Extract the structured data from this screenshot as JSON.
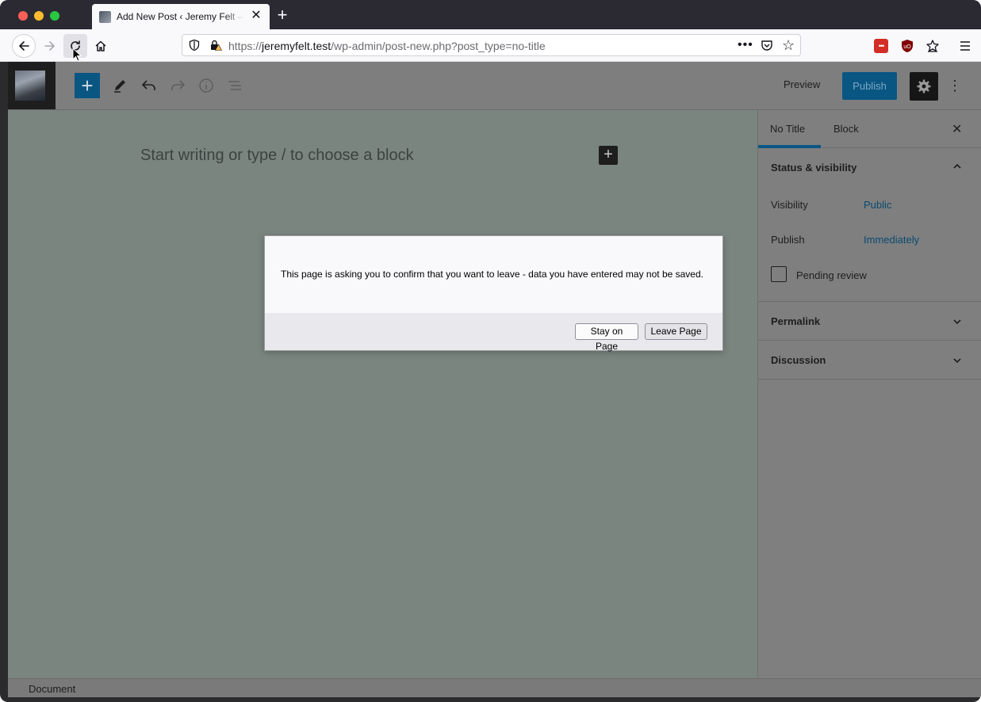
{
  "browser": {
    "tab_title": "Add New Post ‹ Jeremy Felt — WordPress",
    "tab_close": "✕",
    "new_tab": "+",
    "url_scheme": "https://",
    "url_host": "jeremyfelt.test",
    "url_path": "/wp-admin/post-new.php?post_type=no-title",
    "url_more": "•••",
    "lastpass_label": "•••"
  },
  "wp_toolbar": {
    "add_block": "+",
    "preview": "Preview",
    "publish": "Publish",
    "more": "⋮"
  },
  "editor": {
    "placeholder": "Start writing or type / to choose a block",
    "inline_add": "+"
  },
  "sidebar": {
    "tabs": [
      {
        "label": "No Title"
      },
      {
        "label": "Block"
      }
    ],
    "close": "✕",
    "status_panel": {
      "title": "Status & visibility",
      "visibility_label": "Visibility",
      "visibility_value": "Public",
      "publish_label": "Publish",
      "publish_value": "Immediately",
      "pending_label": "Pending review"
    },
    "permalink_title": "Permalink",
    "discussion_title": "Discussion"
  },
  "statusbar": {
    "breadcrumb": "Document"
  },
  "dialog": {
    "message": "This page is asking you to confirm that you want to leave - data you have entered may not be saved.",
    "stay_label": "Stay on Page",
    "leave_label": "Leave Page"
  },
  "colors": {
    "wp_accent": "#0a5683",
    "link": "#0a4a70",
    "tabstrip": "#2b2a33"
  }
}
